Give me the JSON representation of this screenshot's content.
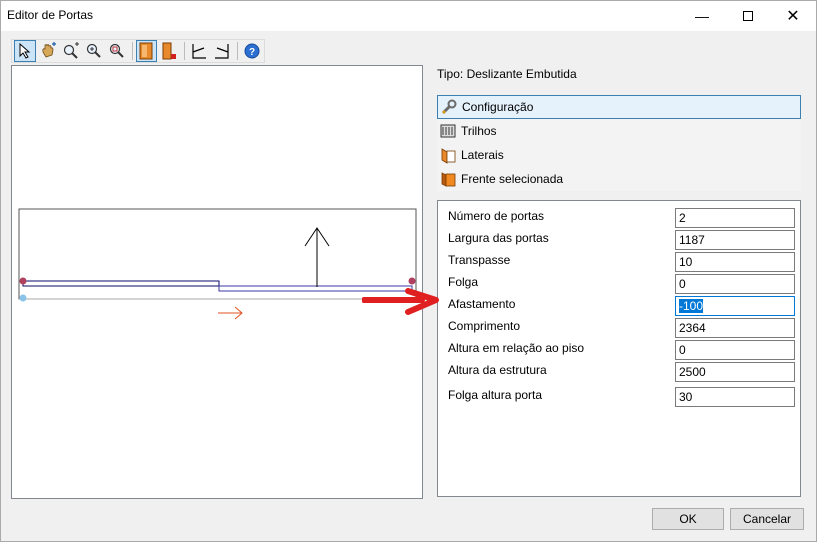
{
  "window": {
    "title": "Editor de Portas"
  },
  "toolbar": {
    "buttons": [
      {
        "icon": "select-arrow-icon"
      },
      {
        "icon": "pan-hand-icon"
      },
      {
        "icon": "zoom-window-icon"
      },
      {
        "icon": "zoom-in-icon"
      },
      {
        "icon": "zoom-extents-icon"
      },
      {
        "icon": "door-front-icon"
      },
      {
        "icon": "door-side-icon"
      },
      {
        "icon": "profile-left-icon"
      },
      {
        "icon": "profile-right-icon"
      },
      {
        "icon": "help-icon"
      }
    ]
  },
  "panel": {
    "tipo": "Tipo: Deslizante Embutida",
    "sections": [
      {
        "label": "Configuração",
        "icon": "wrench-icon"
      },
      {
        "label": "Trilhos",
        "icon": "rails-icon"
      },
      {
        "label": "Laterais",
        "icon": "laterais-icon"
      },
      {
        "label": "Frente selecionada",
        "icon": "front-icon"
      }
    ],
    "properties": [
      {
        "label": "Número de portas",
        "value": "2"
      },
      {
        "label": "Largura das portas",
        "value": "1187"
      },
      {
        "label": "Transpasse",
        "value": "10"
      },
      {
        "label": "Folga",
        "value": "0"
      },
      {
        "label": "Afastamento",
        "value": "-100"
      },
      {
        "label": "Comprimento",
        "value": "2364"
      },
      {
        "label": "Altura em relação ao piso",
        "value": "0"
      },
      {
        "label": "Altura da estrutura",
        "value": "2500"
      },
      {
        "label": "Folga altura porta",
        "value": "30"
      }
    ]
  },
  "buttons": {
    "ok": "OK",
    "cancel": "Cancelar"
  },
  "colors": {
    "annotation_arrow": "#e02020",
    "accent": "#0078d7"
  }
}
